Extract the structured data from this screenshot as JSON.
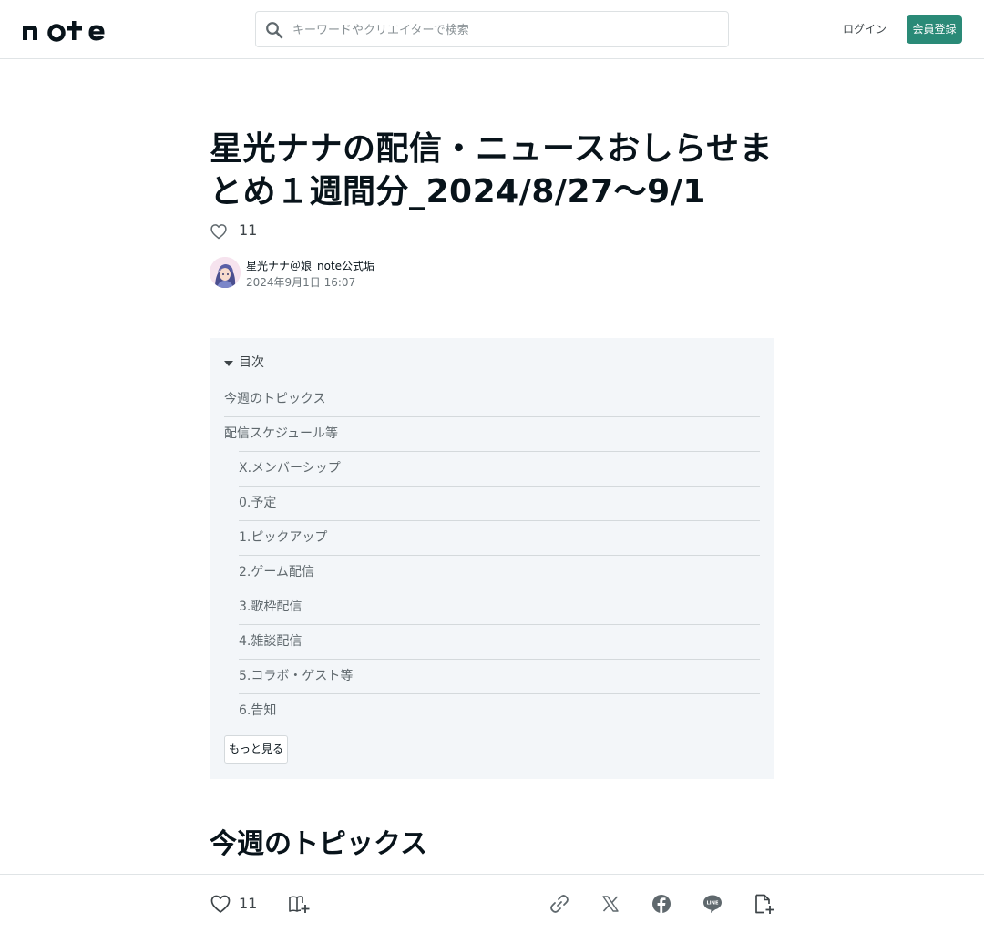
{
  "header": {
    "logo_text": "note",
    "search_placeholder": "キーワードやクリエイターで検索",
    "login_label": "ログイン",
    "signup_label": "会員登録"
  },
  "article": {
    "title": "星光ナナの配信・ニュースおしらせまとめ１週間分_2024/8/27～9/1",
    "like_count": "11",
    "author_name": "星光ナナ＠娘_note公式垢",
    "date": "2024年9月1日 16:07",
    "section_heading": "今週のトピックス"
  },
  "toc": {
    "heading": "目次",
    "items": [
      {
        "label": "今週のトピックス",
        "level": 1
      },
      {
        "label": "配信スケジュール等",
        "level": 1
      },
      {
        "label": "X.メンバーシップ",
        "level": 2
      },
      {
        "label": "0.予定",
        "level": 2
      },
      {
        "label": "1.ピックアップ",
        "level": 2
      },
      {
        "label": "2.ゲーム配信",
        "level": 2
      },
      {
        "label": "3.歌枠配信",
        "level": 2
      },
      {
        "label": "4.雑談配信",
        "level": 2
      },
      {
        "label": "5.コラボ・ゲスト等",
        "level": 2
      },
      {
        "label": "6.告知",
        "level": 2
      }
    ],
    "more_label": "もっと見る"
  },
  "bottom_bar": {
    "like_count": "11",
    "icons": [
      "heart-icon",
      "magazine-add-icon",
      "link-icon",
      "x-icon",
      "facebook-icon",
      "line-icon",
      "save-note-icon"
    ]
  },
  "colors": {
    "accent": "#2a8a77",
    "toc_bg": "#f3f6f9",
    "text": "#08131a",
    "muted": "#5f686d"
  }
}
